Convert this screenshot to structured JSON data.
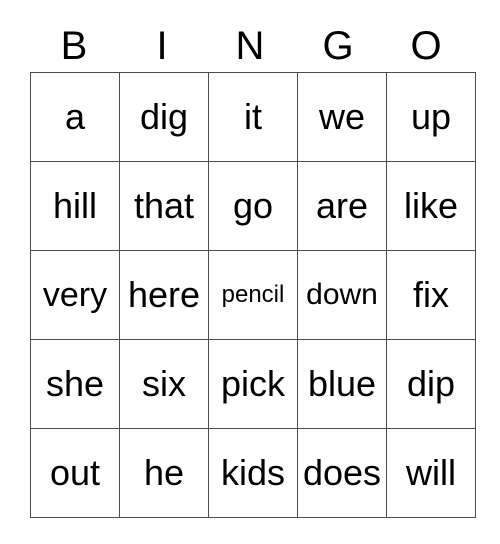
{
  "card": {
    "title": "BINGO",
    "headers": [
      "B",
      "I",
      "N",
      "G",
      "O"
    ],
    "rows": [
      [
        {
          "text": "a",
          "size": "base"
        },
        {
          "text": "dig",
          "size": "base"
        },
        {
          "text": "it",
          "size": "base"
        },
        {
          "text": "we",
          "size": "base"
        },
        {
          "text": "up",
          "size": "base"
        }
      ],
      [
        {
          "text": "hill",
          "size": "base"
        },
        {
          "text": "that",
          "size": "base"
        },
        {
          "text": "go",
          "size": "base"
        },
        {
          "text": "are",
          "size": "base"
        },
        {
          "text": "like",
          "size": "base"
        }
      ],
      [
        {
          "text": "very",
          "size": "lg"
        },
        {
          "text": "here",
          "size": "base"
        },
        {
          "text": "pencil",
          "size": "sm"
        },
        {
          "text": "down",
          "size": "md"
        },
        {
          "text": "fix",
          "size": "base"
        }
      ],
      [
        {
          "text": "she",
          "size": "base"
        },
        {
          "text": "six",
          "size": "base"
        },
        {
          "text": "pick",
          "size": "base"
        },
        {
          "text": "blue",
          "size": "base"
        },
        {
          "text": "dip",
          "size": "base"
        }
      ],
      [
        {
          "text": "out",
          "size": "base"
        },
        {
          "text": "he",
          "size": "base"
        },
        {
          "text": "kids",
          "size": "base"
        },
        {
          "text": "does",
          "size": "base"
        },
        {
          "text": "will",
          "size": "base"
        }
      ]
    ]
  },
  "colors": {
    "background": "#ffffff",
    "text": "#000000",
    "grid_line": "#4d4d4d"
  }
}
